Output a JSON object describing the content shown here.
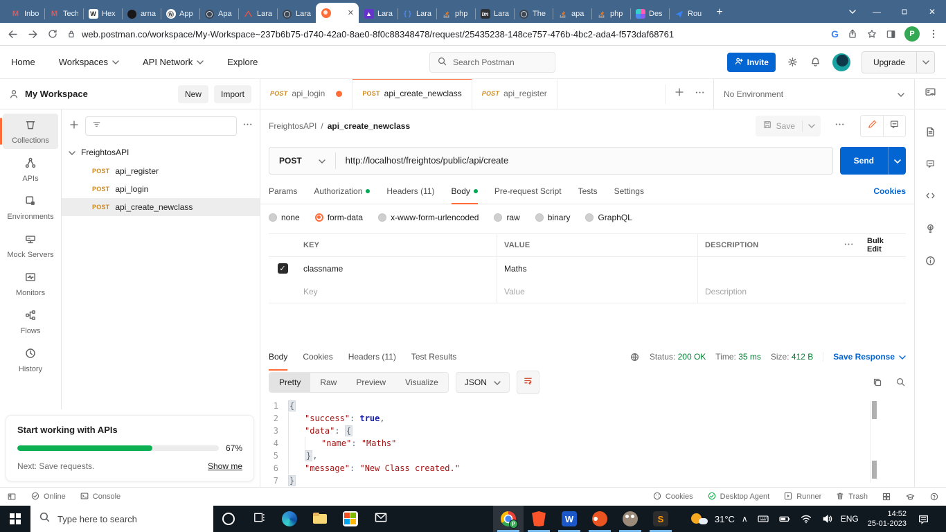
{
  "colors": {
    "accent_orange": "#ff6c37",
    "method_post": "#cf8a1d",
    "action_blue": "#0265d2",
    "status_green": "#007f31",
    "progress_green": "#0db154",
    "chrome_bar": "#41658b"
  },
  "browser": {
    "tabs": [
      {
        "icon": "gmail",
        "label": "Inbo"
      },
      {
        "icon": "gmail",
        "label": "Tech"
      },
      {
        "icon": "wiki",
        "label": "Hex"
      },
      {
        "icon": "github",
        "label": "arna"
      },
      {
        "icon": "wordpress",
        "label": "App"
      },
      {
        "icon": "globe",
        "label": "Apa"
      },
      {
        "icon": "laravel",
        "label": "Lara"
      },
      {
        "icon": "globe",
        "label": "Lara"
      },
      {
        "icon": "postman",
        "label": "",
        "active": true
      },
      {
        "icon": "rocket",
        "label": "Lara"
      },
      {
        "icon": "braces",
        "label": "Lara"
      },
      {
        "icon": "stackoverflow",
        "label": "php"
      },
      {
        "icon": "tm",
        "label": "Lara"
      },
      {
        "icon": "globe",
        "label": "The"
      },
      {
        "icon": "stackoverflow",
        "label": "apa"
      },
      {
        "icon": "stackoverflow",
        "label": "php"
      },
      {
        "icon": "designer",
        "label": "Des"
      },
      {
        "icon": "route",
        "label": "Rou"
      }
    ],
    "url": "web.postman.co/workspace/My-Workspace~237b6b75-d740-42a0-8ae0-8f0c88348478/request/25435238-148ce757-476b-4bc2-ada4-f573daf68761",
    "profile_initial": "P"
  },
  "postman_nav": {
    "menu": [
      {
        "label": "Home",
        "chevron": false
      },
      {
        "label": "Workspaces",
        "chevron": true
      },
      {
        "label": "API Network",
        "chevron": true
      },
      {
        "label": "Explore",
        "chevron": false
      }
    ],
    "search": "Search Postman",
    "invite": "Invite",
    "upgrade": "Upgrade"
  },
  "sidebar": {
    "workspace": "My Workspace",
    "new_btn": "New",
    "import_btn": "Import",
    "rail": [
      {
        "icon": "collections",
        "label": "Collections",
        "active": true
      },
      {
        "icon": "apis",
        "label": "APIs"
      },
      {
        "icon": "envs",
        "label": "Environments"
      },
      {
        "icon": "mock",
        "label": "Mock Servers"
      },
      {
        "icon": "monitors",
        "label": "Monitors"
      },
      {
        "icon": "flows",
        "label": "Flows"
      },
      {
        "icon": "history",
        "label": "History"
      }
    ],
    "collection": "FreightosAPI",
    "requests": [
      {
        "method": "POST",
        "name": "api_register",
        "selected": false
      },
      {
        "method": "POST",
        "name": "api_login",
        "selected": false
      },
      {
        "method": "POST",
        "name": "api_create_newclass",
        "selected": true
      }
    ]
  },
  "onboarding": {
    "title": "Start working with APIs",
    "percent": "67%",
    "progress": 67,
    "next": "Next: Save requests.",
    "show_me": "Show me"
  },
  "workbench": {
    "request_tabs": [
      {
        "method": "POST",
        "name": "api_login",
        "dirty": true,
        "active": false
      },
      {
        "method": "POST",
        "name": "api_create_newclass",
        "dirty": false,
        "active": true
      },
      {
        "method": "POST",
        "name": "api_register",
        "dirty": false,
        "active": false
      }
    ],
    "environment": "No Environment",
    "breadcrumb": {
      "collection": "FreightosAPI",
      "separator": "/",
      "request": "api_create_newclass"
    },
    "save_label": "Save",
    "method": "POST",
    "url": "http://localhost/freightos/public/api/create",
    "send_label": "Send",
    "req_tabs": [
      {
        "label": "Params",
        "dot": false,
        "active": false
      },
      {
        "label": "Authorization",
        "dot": true,
        "active": false
      },
      {
        "label": "Headers (11)",
        "dot": false,
        "active": false
      },
      {
        "label": "Body",
        "dot": true,
        "active": true
      },
      {
        "label": "Pre-request Script",
        "dot": false,
        "active": false
      },
      {
        "label": "Tests",
        "dot": false,
        "active": false
      },
      {
        "label": "Settings",
        "dot": false,
        "active": false
      }
    ],
    "cookies_link": "Cookies",
    "body_types": [
      {
        "label": "none",
        "selected": false
      },
      {
        "label": "form-data",
        "selected": true
      },
      {
        "label": "x-www-form-urlencoded",
        "selected": false
      },
      {
        "label": "raw",
        "selected": false
      },
      {
        "label": "binary",
        "selected": false
      },
      {
        "label": "GraphQL",
        "selected": false
      }
    ],
    "table": {
      "col_key": "KEY",
      "col_value": "VALUE",
      "col_desc": "DESCRIPTION",
      "bulk_edit": "Bulk Edit",
      "rows": [
        {
          "key": "classname",
          "value": "Maths",
          "desc": "",
          "checked": true
        }
      ],
      "ph_key": "Key",
      "ph_value": "Value",
      "ph_desc": "Description"
    }
  },
  "response": {
    "tabs": [
      {
        "label": "Body",
        "active": true
      },
      {
        "label": "Cookies",
        "active": false
      },
      {
        "label": "Headers (11)",
        "active": false
      },
      {
        "label": "Test Results",
        "active": false
      }
    ],
    "status_label": "Status:",
    "status_value": "200 OK",
    "time_label": "Time:",
    "time_value": "35 ms",
    "size_label": "Size:",
    "size_value": "412 B",
    "save_response": "Save Response",
    "views": [
      {
        "label": "Pretty",
        "active": true
      },
      {
        "label": "Raw",
        "active": false
      },
      {
        "label": "Preview",
        "active": false
      },
      {
        "label": "Visualize",
        "active": false
      }
    ],
    "format": "JSON",
    "code": [
      {
        "n": "1",
        "indent": 0,
        "tokens": [
          {
            "c": "br",
            "v": "{"
          }
        ]
      },
      {
        "n": "2",
        "indent": 1,
        "tokens": [
          {
            "c": "k",
            "v": "\"success\""
          },
          {
            "c": "p",
            "v": ": "
          },
          {
            "c": "b",
            "v": "true"
          },
          {
            "c": "p",
            "v": ","
          }
        ]
      },
      {
        "n": "3",
        "indent": 1,
        "tokens": [
          {
            "c": "k",
            "v": "\"data\""
          },
          {
            "c": "p",
            "v": ": "
          },
          {
            "c": "br",
            "v": "{"
          }
        ]
      },
      {
        "n": "4",
        "indent": 2,
        "tokens": [
          {
            "c": "k",
            "v": "\"name\""
          },
          {
            "c": "p",
            "v": ": "
          },
          {
            "c": "s",
            "v": "\"Maths\""
          }
        ]
      },
      {
        "n": "5",
        "indent": 1,
        "tokens": [
          {
            "c": "br",
            "v": "}"
          },
          {
            "c": "p",
            "v": ","
          }
        ]
      },
      {
        "n": "6",
        "indent": 1,
        "tokens": [
          {
            "c": "k",
            "v": "\"message\""
          },
          {
            "c": "p",
            "v": ": "
          },
          {
            "c": "s",
            "v": "\"New Class created.\""
          }
        ]
      },
      {
        "n": "7",
        "indent": 0,
        "tokens": [
          {
            "c": "br",
            "v": "}"
          }
        ]
      }
    ]
  },
  "status_bar": {
    "online": "Online",
    "console": "Console",
    "cookies": "Cookies",
    "desktop_agent": "Desktop Agent",
    "runner": "Runner",
    "trash": "Trash"
  },
  "taskbar": {
    "search_ph": "Type here to search",
    "running_apps": [
      "chrome",
      "brave",
      "word",
      "ubuntu",
      "gimp",
      "sublime"
    ],
    "chrome_badge": "P",
    "temp": "31°C",
    "lang": "ENG",
    "time": "14:52",
    "date": "25-01-2023"
  }
}
